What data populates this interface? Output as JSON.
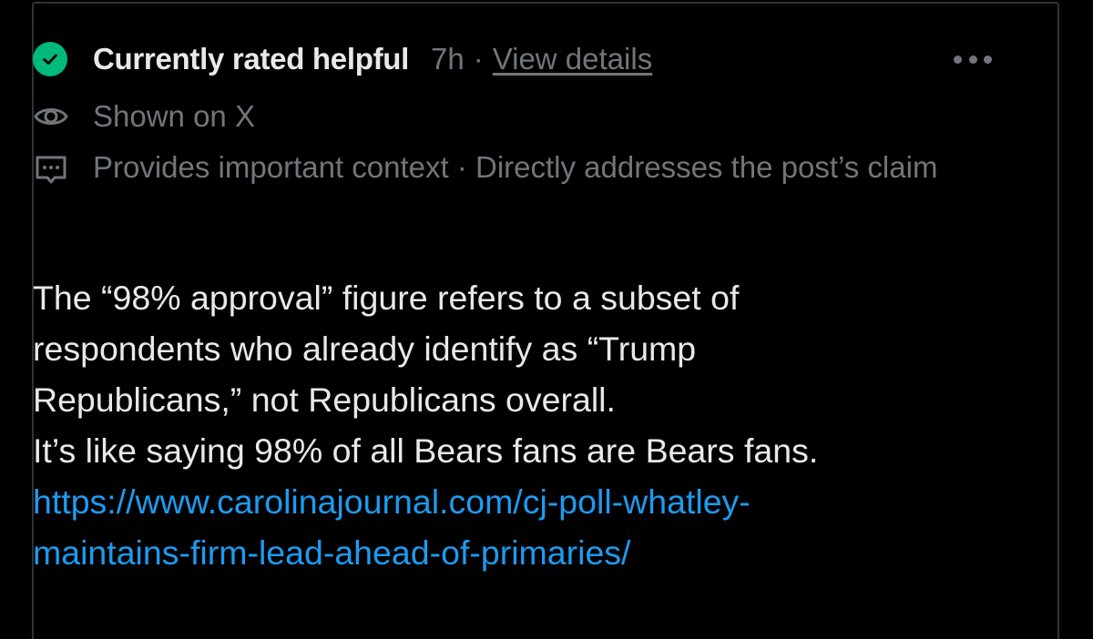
{
  "note": {
    "status_label": "Currently rated helpful",
    "time_ago": "7h",
    "separator": "·",
    "view_details_label": "View details",
    "shown_on": "Shown on X",
    "reasons": "Provides important context · Directly addresses the post’s claim",
    "body_lines": [
      "The “98% approval” figure refers to a subset of",
      "respondents who already identify as “Trump",
      "Republicans,” not Republicans overall.",
      "It’s like saying 98% of all Bears fans are Bears fans."
    ],
    "link_lines": [
      "https://www.carolinajournal.com/cj-poll-whatley-",
      "maintains-firm-lead-ahead-of-primaries/"
    ]
  },
  "icons": {
    "status": "check-circle-icon",
    "shown": "eye-icon",
    "reasons": "message-icon",
    "more": "more-options-icon"
  },
  "colors": {
    "background": "#000000",
    "helpful_green": "#00ba7c",
    "primary_text": "#e7e9ea",
    "secondary_text": "#71767b",
    "link": "#1d9bf0"
  }
}
